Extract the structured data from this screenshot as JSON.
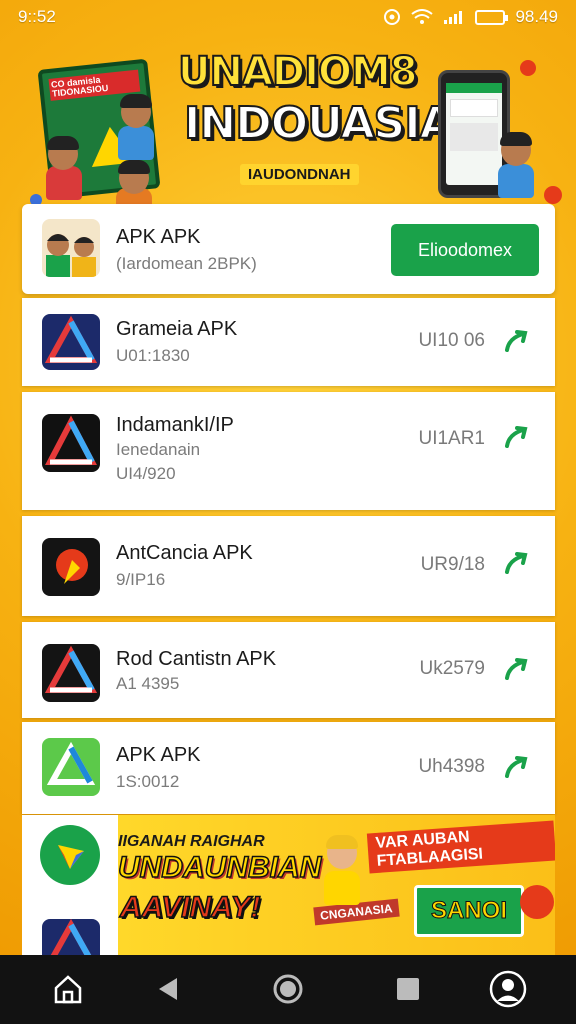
{
  "status_bar": {
    "time": "9::52",
    "right_time": "98.49",
    "icons": [
      "shield-icon",
      "wifi-icon",
      "signal-icon",
      "battery-icon"
    ]
  },
  "hero": {
    "title_line1": "UNADIOM8",
    "title_line2": "INDOUASIA",
    "subtitle": "IAUDONDNAH",
    "poster_text": "CO damisla TIDONASIOU"
  },
  "featured": {
    "name": "APK APK",
    "subtitle": "(Iardomean 2BPK)",
    "button_label": "Elioodomex"
  },
  "apps": [
    {
      "name": "Grameia APK",
      "sub1": "U01:1830",
      "sub2": "",
      "size": "UI10 06",
      "icon": "triangle-logo-navy"
    },
    {
      "name": "IndamankI/IP",
      "sub1": "Ienedanain",
      "sub2": "UI4/920",
      "size": "UI1AR1",
      "icon": "triangle-logo-black"
    },
    {
      "name": "AntCancia APK",
      "sub1": "9/IP16",
      "sub2": "",
      "size": "UR9/18",
      "icon": "flame-logo"
    },
    {
      "name": "Rod Cantistn APK",
      "sub1": "A1 4395",
      "sub2": "",
      "size": "Uk2579",
      "icon": "triangle-logo-black"
    },
    {
      "name": "APK APK",
      "sub1": "1S:0012",
      "sub2": "",
      "size": "Uh4398",
      "icon": "triangle-logo-green"
    }
  ],
  "banner": {
    "line1": "IIGANAH RAIGHAR",
    "line2": "UNDAUNBIAN",
    "line3": "AAVINAY!",
    "tag1": "VAR AUBAN FTABLAAGISI",
    "tag2": "SANOI",
    "tag3": "CNGANASIA"
  },
  "nav": {
    "icons": [
      "home-icon",
      "back-icon",
      "circle-home-icon",
      "recents-icon",
      "profile-icon"
    ]
  },
  "colors": {
    "accent_green": "#1aa24a",
    "background_orange": "#f7b212"
  }
}
